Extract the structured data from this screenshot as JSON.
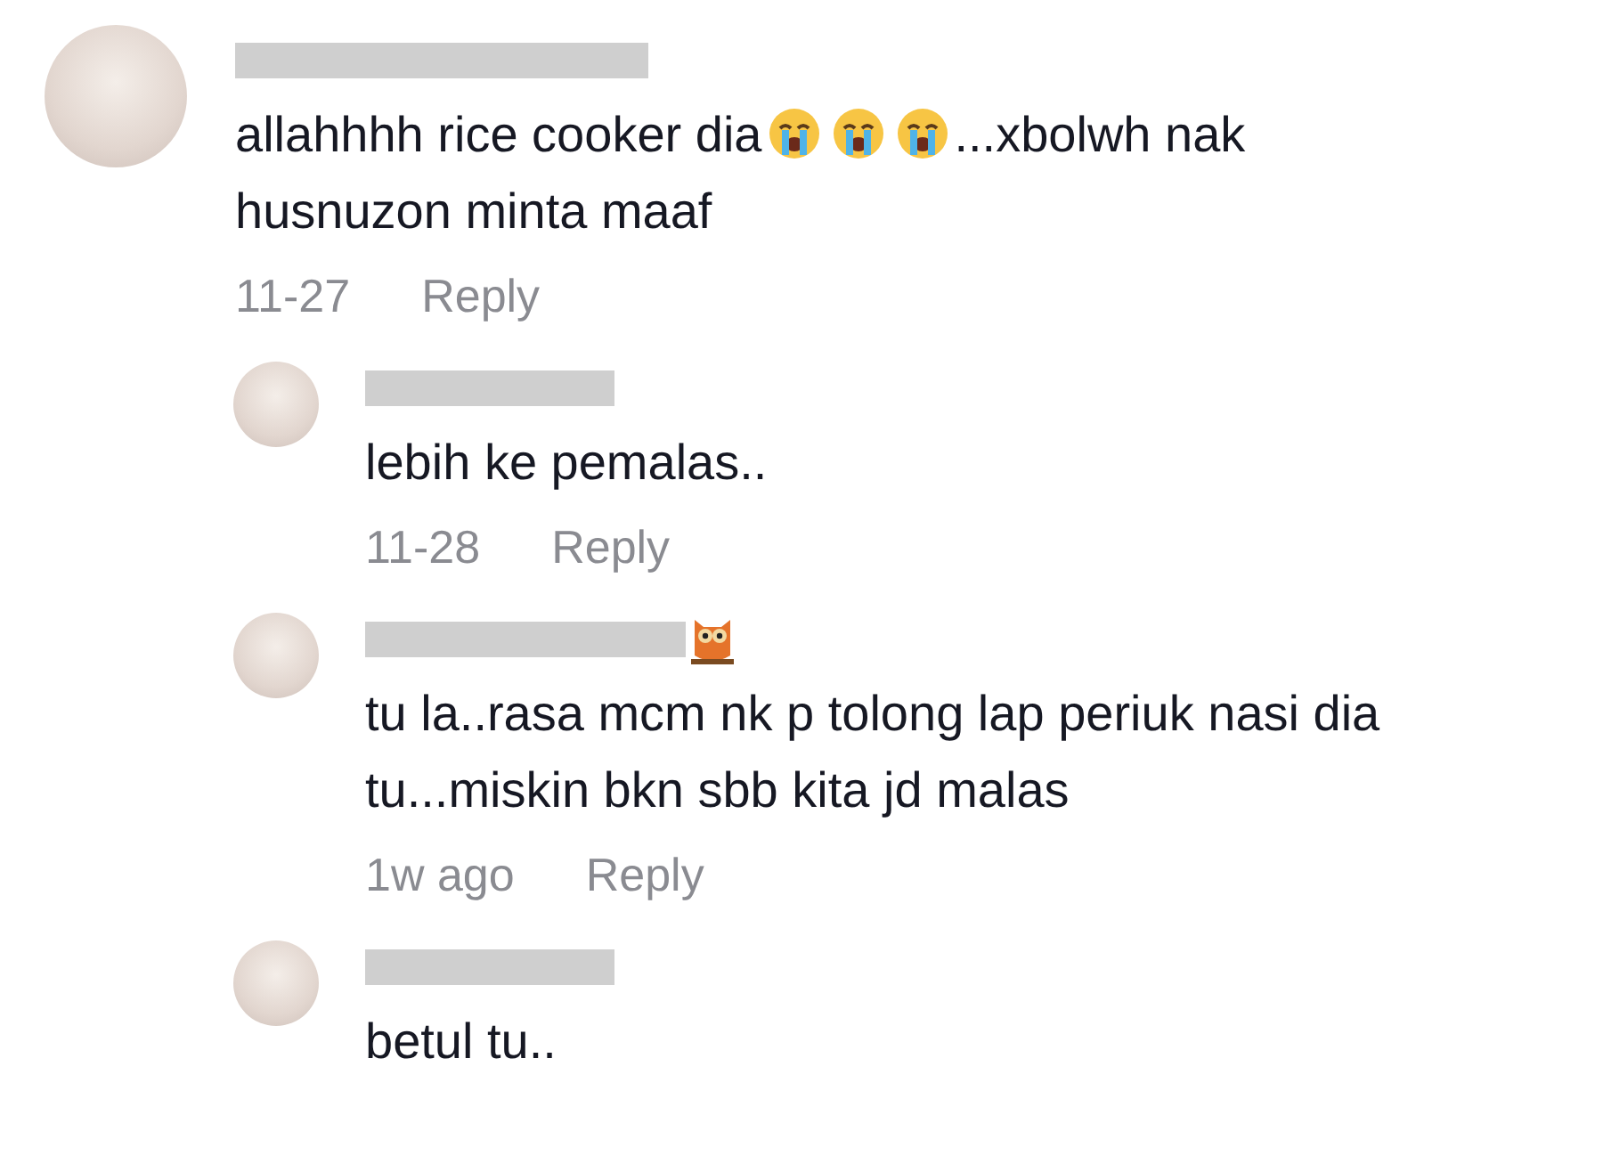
{
  "comment": {
    "author_redacted": true,
    "author_badge": false,
    "segments": [
      {
        "kind": "text",
        "text": "allahhhh rice cooker dia"
      },
      {
        "kind": "emoji"
      },
      {
        "kind": "emoji"
      },
      {
        "kind": "emoji"
      },
      {
        "kind": "text",
        "text": "...xbolwh nak husnuzon minta maaf"
      }
    ],
    "time": "11-27",
    "reply_label": "Reply",
    "replies": [
      {
        "author_redacted": true,
        "author_badge": false,
        "segments": [
          {
            "kind": "text",
            "text": "lebih ke pemalas.."
          }
        ],
        "time": "11-28",
        "reply_label": "Reply"
      },
      {
        "author_redacted": true,
        "author_badge": true,
        "segments": [
          {
            "kind": "text",
            "text": "tu la..rasa mcm nk p tolong lap periuk nasi dia tu...miskin bkn sbb kita jd malas"
          }
        ],
        "time": "1w ago",
        "reply_label": "Reply"
      },
      {
        "author_redacted": true,
        "author_badge": false,
        "segments": [
          {
            "kind": "text",
            "text": "betul tu.."
          }
        ]
      }
    ]
  }
}
